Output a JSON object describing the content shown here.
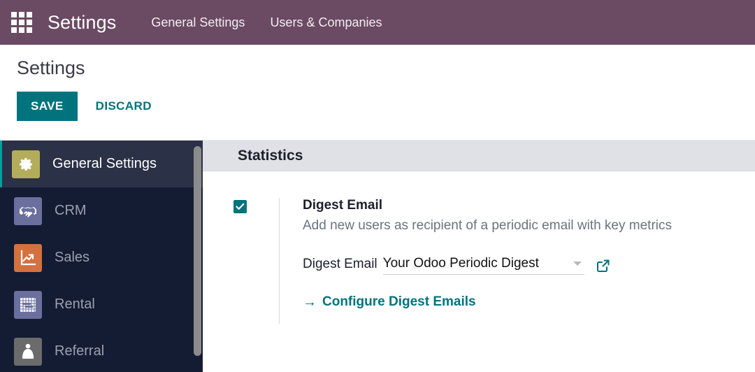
{
  "navbar": {
    "apps_icon": "apps-grid-icon",
    "brand": "Settings",
    "menu_items": [
      {
        "label": "General Settings"
      },
      {
        "label": "Users & Companies"
      }
    ],
    "background_color": "#6b4a63"
  },
  "control_panel": {
    "title": "Settings",
    "save_label": "SAVE",
    "discard_label": "DISCARD",
    "accent_color": "#00737d"
  },
  "sidebar": {
    "items": [
      {
        "label": "General Settings",
        "icon": "gear-icon",
        "icon_color": "#b3ac5b",
        "active": true
      },
      {
        "label": "CRM",
        "icon": "handshake-icon",
        "icon_color": "#6b6f9e",
        "active": false
      },
      {
        "label": "Sales",
        "icon": "chart-arrow-icon",
        "icon_color": "#d4713f",
        "active": false
      },
      {
        "label": "Rental",
        "icon": "calendar-form-icon",
        "icon_color": "#6b6f9e",
        "active": false
      },
      {
        "label": "Referral",
        "icon": "caped-person-icon",
        "icon_color": "#6b6b6b",
        "active": false
      }
    ],
    "active_border_color": "#00a09d",
    "background_color": "#141c33"
  },
  "settings": {
    "section_title": "Statistics",
    "digest": {
      "checkbox_checked": true,
      "title": "Digest Email",
      "description": "Add new users as recipient of a periodic email with key metrics",
      "field_label": "Digest Email",
      "field_value": "Your Odoo Periodic Digest",
      "dropdown_icon": "chevron-down-icon",
      "external_link_icon": "external-link-icon",
      "configure_link": "Configure Digest Emails",
      "configure_arrow": "→"
    }
  }
}
